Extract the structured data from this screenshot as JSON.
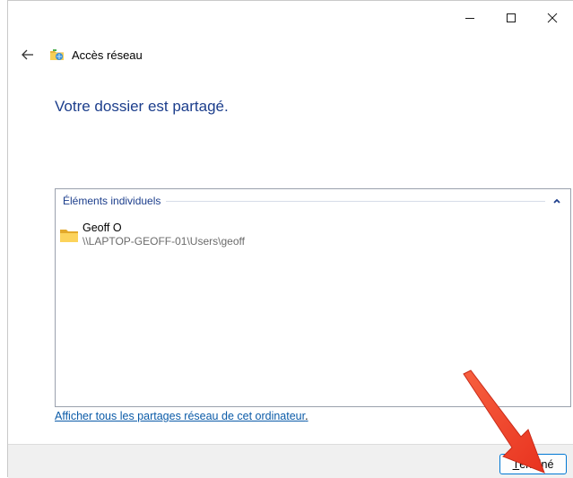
{
  "window": {
    "title": "Accès réseau",
    "caption": {
      "minimize_icon": "minimize-icon",
      "maximize_icon": "maximize-icon",
      "close_icon": "close-icon"
    }
  },
  "main": {
    "heading": "Votre dossier est partagé.",
    "group": {
      "title": "Éléments individuels",
      "items": [
        {
          "name": "Geoff O",
          "path": "\\\\LAPTOP-GEOFF-01\\Users\\geoff"
        }
      ]
    },
    "link_text": "Afficher tous les partages réseau de cet ordinateur",
    "link_suffix": "."
  },
  "footer": {
    "done_label_accel": "T",
    "done_label_rest": "erminé"
  },
  "colors": {
    "heading": "#1c3e8c",
    "link": "#0b5ba8",
    "annotation_arrow": "#f0402a",
    "button_border": "#0078d4"
  }
}
